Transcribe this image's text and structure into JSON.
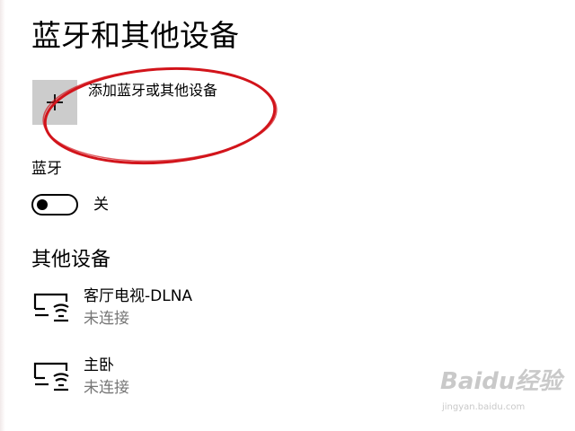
{
  "header": {
    "title": "蓝牙和其他设备"
  },
  "add_device": {
    "label": "添加蓝牙或其他设备",
    "icon": "plus-icon"
  },
  "bluetooth": {
    "label": "蓝牙",
    "toggle_state": "关",
    "enabled": false
  },
  "other_devices": {
    "title": "其他设备",
    "items": [
      {
        "name": "客厅电视-DLNA",
        "status": "未连接",
        "icon": "media-device-icon"
      },
      {
        "name": "主卧",
        "status": "未连接",
        "icon": "media-device-icon"
      }
    ]
  },
  "annotation": {
    "color": "#d2141b"
  },
  "watermark": {
    "logo": "Baidu经验",
    "url": "jingyan.baidu.com"
  }
}
